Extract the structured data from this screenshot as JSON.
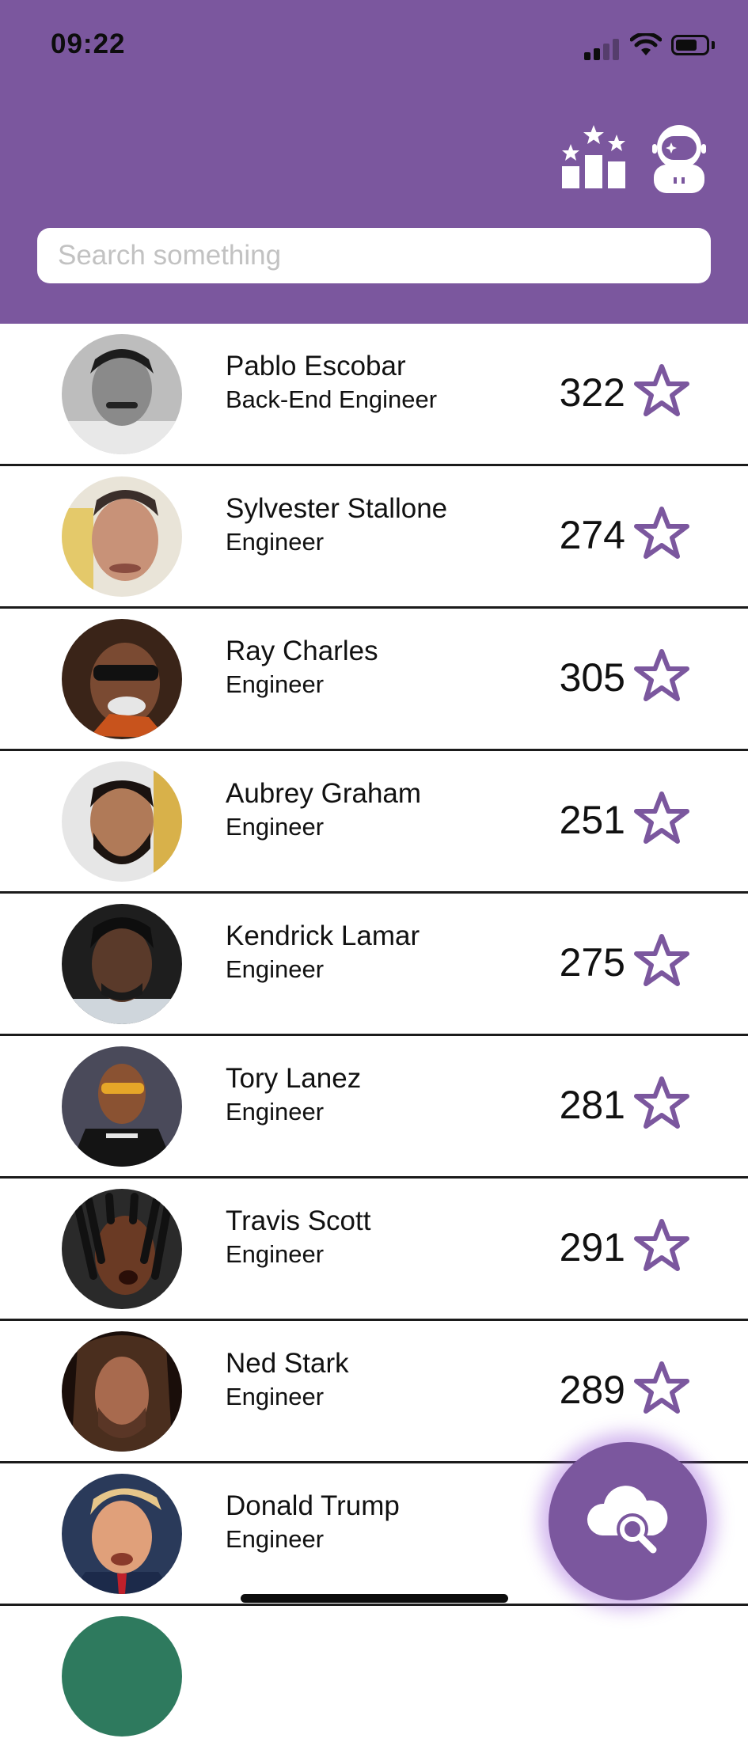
{
  "status_bar": {
    "time": "09:22"
  },
  "header": {
    "icons": [
      "leaderboard-icon",
      "astronaut-profile-icon"
    ],
    "accent_color": "#7b579e"
  },
  "search": {
    "placeholder": "Search something",
    "value": ""
  },
  "rows": [
    {
      "name": "Pablo Escobar",
      "role": "Back-End Engineer",
      "score": "322"
    },
    {
      "name": "Sylvester Stallone",
      "role": "Engineer",
      "score": "274"
    },
    {
      "name": "Ray Charles",
      "role": "Engineer",
      "score": "305"
    },
    {
      "name": "Aubrey Graham",
      "role": "Engineer",
      "score": "251"
    },
    {
      "name": "Kendrick Lamar",
      "role": "Engineer",
      "score": "275"
    },
    {
      "name": "Tory Lanez",
      "role": "Engineer",
      "score": "281"
    },
    {
      "name": "Travis Scott",
      "role": "Engineer",
      "score": "291"
    },
    {
      "name": "Ned Stark",
      "role": "Engineer",
      "score": "289"
    },
    {
      "name": "Donald Trump",
      "role": "Engineer",
      "score": ""
    }
  ],
  "fab": {
    "icon": "cloud-search-icon"
  }
}
